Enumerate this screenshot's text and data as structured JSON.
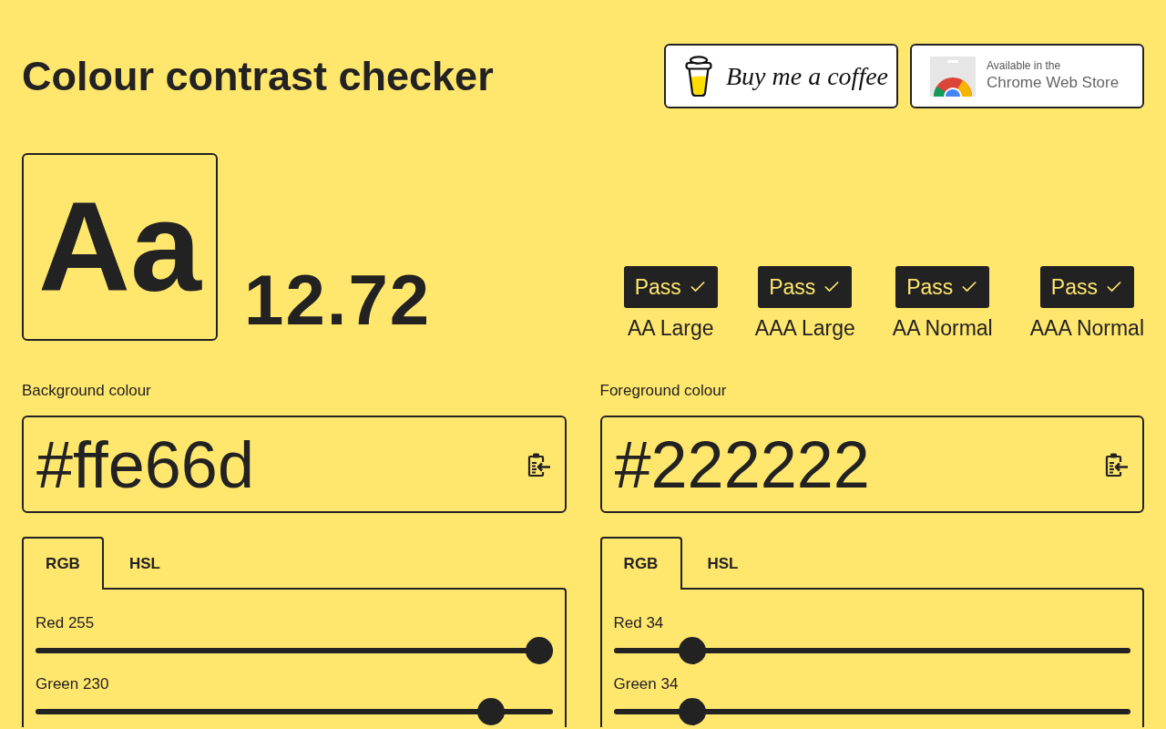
{
  "header": {
    "title": "Colour contrast checker",
    "buttons": [
      {
        "kind": "coffee",
        "label": "Buy me a coffee"
      },
      {
        "kind": "store",
        "caption": "Available in the",
        "label": "Chrome Web Store"
      }
    ]
  },
  "preview": {
    "sample": "Aa",
    "ratio": "12.72"
  },
  "results": [
    {
      "status": "Pass",
      "passed": true,
      "label": "AA Large"
    },
    {
      "status": "Pass",
      "passed": true,
      "label": "AAA Large"
    },
    {
      "status": "Pass",
      "passed": true,
      "label": "AA Normal"
    },
    {
      "status": "Pass",
      "passed": true,
      "label": "AAA Normal"
    }
  ],
  "colours": [
    {
      "label": "Background colour",
      "value": "#ffe66d",
      "tabs": [
        {
          "label": "RGB",
          "selected": true
        },
        {
          "label": "HSL",
          "selected": false
        }
      ],
      "channels": [
        {
          "label": "Red 255",
          "level": 1
        },
        {
          "label": "Green 230",
          "level": 0.902
        }
      ]
    },
    {
      "label": "Foreground colour",
      "value": "#222222",
      "tabs": [
        {
          "label": "RGB",
          "selected": true
        },
        {
          "label": "HSL",
          "selected": false
        }
      ],
      "channels": [
        {
          "label": "Red 34",
          "level": 0.133
        },
        {
          "label": "Green 34",
          "level": 0.133
        }
      ]
    }
  ]
}
